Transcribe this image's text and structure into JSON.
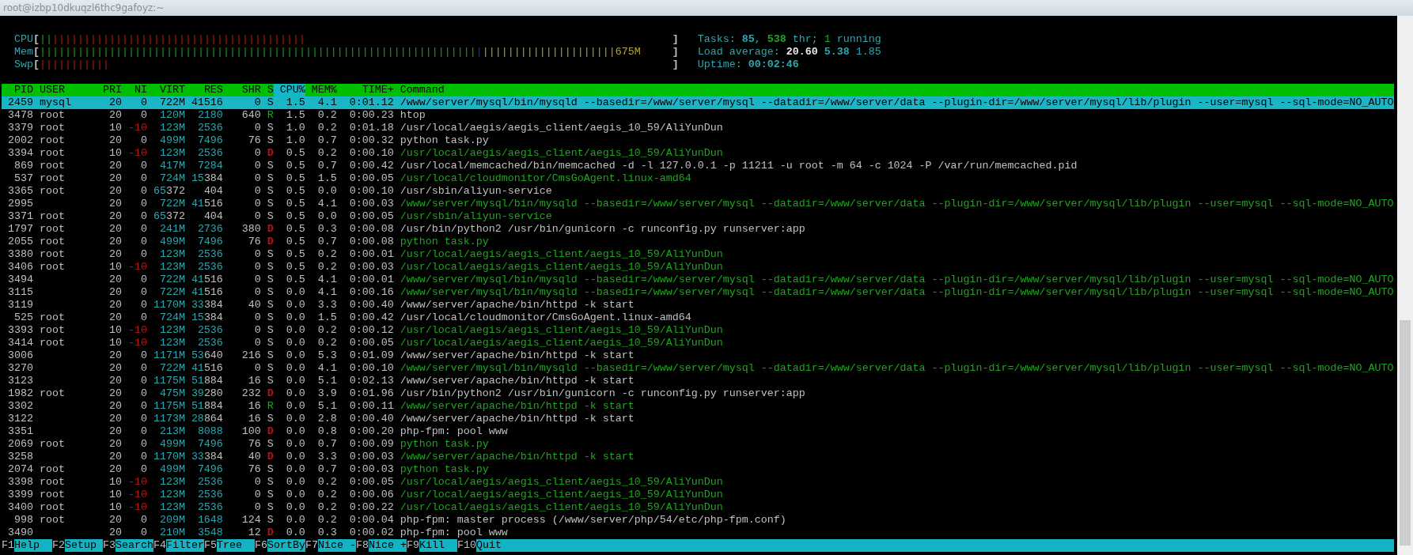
{
  "window": {
    "title": "root@izbp10dkuqzl6thc9gafoyz:~"
  },
  "meters": [
    {
      "label": "CPU",
      "open": "[",
      "close": "]",
      "segments": [
        {
          "text": "||",
          "kind": "user"
        },
        {
          "text": "||||||||||||||||||||||||||||||||||||||||",
          "kind": "kernel"
        }
      ]
    },
    {
      "label": "Mem",
      "open": "[",
      "close": "]",
      "segments": [
        {
          "text": "|||||||||||||||||||||||||||||||||||||||||||||||||||||||||||||||||||||",
          "kind": "used"
        },
        {
          "text": "|",
          "kind": "buffers"
        },
        {
          "text": "|||||||||||||||||||||",
          "kind": "cache"
        }
      ],
      "value": "675M"
    },
    {
      "label": "Swp",
      "open": "[",
      "close": "]",
      "segments": [
        {
          "text": "|||||||||||",
          "kind": "swap"
        }
      ]
    }
  ],
  "summary": [
    [
      {
        "text": "Tasks: ",
        "kind": "label"
      },
      {
        "text": "85",
        "kind": "value"
      },
      {
        "text": ", ",
        "kind": "label"
      },
      {
        "text": "538",
        "kind": "thread"
      },
      {
        "text": " thr; ",
        "kind": "label"
      },
      {
        "text": "1",
        "kind": "running"
      },
      {
        "text": " running",
        "kind": "label"
      }
    ],
    [
      {
        "text": "Load average: ",
        "kind": "label"
      },
      {
        "text": "20.60 ",
        "kind": "bright"
      },
      {
        "text": "5.38",
        "kind": "value"
      },
      {
        "text": " 1.85",
        "kind": "label"
      }
    ],
    [
      {
        "text": "Uptime: ",
        "kind": "label"
      },
      {
        "text": "00:02:46",
        "kind": "value"
      }
    ]
  ],
  "columns": [
    {
      "label": "PID",
      "sorted": false
    },
    {
      "label": "USER",
      "sorted": false
    },
    {
      "label": "PRI",
      "sorted": false
    },
    {
      "label": "NI",
      "sorted": false
    },
    {
      "label": "VIRT",
      "sorted": false
    },
    {
      "label": "RES",
      "sorted": false
    },
    {
      "label": "SHR",
      "sorted": false
    },
    {
      "label": "S",
      "sorted": false
    },
    {
      "label": "CPU%",
      "sorted": true
    },
    {
      "label": "MEM%",
      "sorted": false
    },
    {
      "label": "TIME+",
      "sorted": false
    },
    {
      "label": "Command",
      "sorted": false
    }
  ],
  "rows": [
    {
      "pid": "2459",
      "user": "mysql",
      "pri": "20",
      "ni": "0",
      "virt": "722M",
      "res": "41516",
      "shr": "0",
      "state": "S",
      "cpu": "1.5",
      "mem": "4.1",
      "time": "0:01.12",
      "command": "/www/server/mysql/bin/mysqld --basedir=/www/server/mysql --datadir=/www/server/data --plugin-dir=/www/server/mysql/lib/plugin --user=mysql --sql-mode=NO_AUTO",
      "thread": false,
      "selected": true
    },
    {
      "pid": "3478",
      "user": "root",
      "pri": "20",
      "ni": "0",
      "virt": "120M",
      "res": "2180",
      "shr": "640",
      "state": "R",
      "cpu": "1.5",
      "mem": "0.2",
      "time": "0:00.23",
      "command": "htop",
      "thread": false,
      "selected": false
    },
    {
      "pid": "3379",
      "user": "root",
      "pri": "10",
      "ni": "-10",
      "virt": "123M",
      "res": "2536",
      "shr": "0",
      "state": "S",
      "cpu": "1.0",
      "mem": "0.2",
      "time": "0:01.18",
      "command": "/usr/local/aegis/aegis_client/aegis_10_59/AliYunDun",
      "thread": false,
      "selected": false
    },
    {
      "pid": "2002",
      "user": "root",
      "pri": "20",
      "ni": "0",
      "virt": "499M",
      "res": "7496",
      "shr": "76",
      "state": "S",
      "cpu": "1.0",
      "mem": "0.7",
      "time": "0:00.32",
      "command": "python task.py",
      "thread": false,
      "selected": false
    },
    {
      "pid": "3394",
      "user": "root",
      "pri": "10",
      "ni": "-10",
      "virt": "123M",
      "res": "2536",
      "shr": "0",
      "state": "D",
      "cpu": "0.5",
      "mem": "0.2",
      "time": "0:00.10",
      "command": "/usr/local/aegis/aegis_client/aegis_10_59/AliYunDun",
      "thread": true,
      "selected": false
    },
    {
      "pid": "869",
      "user": "root",
      "pri": "20",
      "ni": "0",
      "virt": "417M",
      "res": "7284",
      "shr": "0",
      "state": "S",
      "cpu": "0.5",
      "mem": "0.7",
      "time": "0:00.42",
      "command": "/usr/local/memcached/bin/memcached -d -l 127.0.0.1 -p 11211 -u root -m 64 -c 1024 -P /var/run/memcached.pid",
      "thread": false,
      "selected": false
    },
    {
      "pid": "537",
      "user": "root",
      "pri": "20",
      "ni": "0",
      "virt": "724M",
      "res": "15384",
      "shr": "0",
      "state": "S",
      "cpu": "0.5",
      "mem": "1.5",
      "time": "0:00.05",
      "command": "/usr/local/cloudmonitor/CmsGoAgent.linux-amd64",
      "thread": true,
      "selected": false
    },
    {
      "pid": "3365",
      "user": "root",
      "pri": "20",
      "ni": "0",
      "virt": "65372",
      "res": "404",
      "shr": "0",
      "state": "S",
      "cpu": "0.5",
      "mem": "0.0",
      "time": "0:00.10",
      "command": "/usr/sbin/aliyun-service",
      "thread": false,
      "selected": false
    },
    {
      "pid": "2995",
      "pri": "20",
      "ni": "0",
      "virt": "722M",
      "res": "41516",
      "shr": "0",
      "state": "S",
      "cpu": "0.5",
      "mem": "4.1",
      "time": "0:00.03",
      "command": "/www/server/mysql/bin/mysqld --basedir=/www/server/mysql --datadir=/www/server/data --plugin-dir=/www/server/mysql/lib/plugin --user=mysql --sql-mode=NO_AUTO",
      "thread": true,
      "selected": false
    },
    {
      "pid": "3371",
      "user": "root",
      "pri": "20",
      "ni": "0",
      "virt": "65372",
      "res": "404",
      "shr": "0",
      "state": "S",
      "cpu": "0.5",
      "mem": "0.0",
      "time": "0:00.05",
      "command": "/usr/sbin/aliyun-service",
      "thread": true,
      "selected": false
    },
    {
      "pid": "1797",
      "user": "root",
      "pri": "20",
      "ni": "0",
      "virt": "241M",
      "res": "2736",
      "shr": "380",
      "state": "D",
      "cpu": "0.5",
      "mem": "0.3",
      "time": "0:00.08",
      "command": "/usr/bin/python2 /usr/bin/gunicorn -c runconfig.py runserver:app",
      "thread": false,
      "selected": false
    },
    {
      "pid": "2055",
      "user": "root",
      "pri": "20",
      "ni": "0",
      "virt": "499M",
      "res": "7496",
      "shr": "76",
      "state": "D",
      "cpu": "0.5",
      "mem": "0.7",
      "time": "0:00.08",
      "command": "python task.py",
      "thread": true,
      "selected": false
    },
    {
      "pid": "3380",
      "user": "root",
      "pri": "20",
      "ni": "0",
      "virt": "123M",
      "res": "2536",
      "shr": "0",
      "state": "S",
      "cpu": "0.5",
      "mem": "0.2",
      "time": "0:00.01",
      "command": "/usr/local/aegis/aegis_client/aegis_10_59/AliYunDun",
      "thread": true,
      "selected": false
    },
    {
      "pid": "3406",
      "user": "root",
      "pri": "10",
      "ni": "-10",
      "virt": "123M",
      "res": "2536",
      "shr": "0",
      "state": "S",
      "cpu": "0.5",
      "mem": "0.2",
      "time": "0:00.03",
      "command": "/usr/local/aegis/aegis_client/aegis_10_59/AliYunDun",
      "thread": true,
      "selected": false
    },
    {
      "pid": "3494",
      "pri": "20",
      "ni": "0",
      "virt": "722M",
      "res": "41516",
      "shr": "0",
      "state": "S",
      "cpu": "0.5",
      "mem": "4.1",
      "time": "0:00.01",
      "command": "/www/server/mysql/bin/mysqld --basedir=/www/server/mysql --datadir=/www/server/data --plugin-dir=/www/server/mysql/lib/plugin --user=mysql --sql-mode=NO_AUTO",
      "thread": true,
      "selected": false
    },
    {
      "pid": "3115",
      "pri": "20",
      "ni": "0",
      "virt": "722M",
      "res": "41516",
      "shr": "0",
      "state": "S",
      "cpu": "0.0",
      "mem": "4.1",
      "time": "0:00.16",
      "command": "/www/server/mysql/bin/mysqld --basedir=/www/server/mysql --datadir=/www/server/data --plugin-dir=/www/server/mysql/lib/plugin --user=mysql --sql-mode=NO_AUTO",
      "thread": true,
      "selected": false
    },
    {
      "pid": "3119",
      "pri": "20",
      "ni": "0",
      "virt": "1170M",
      "res": "33384",
      "shr": "40",
      "state": "S",
      "cpu": "0.0",
      "mem": "3.3",
      "time": "0:00.40",
      "command": "/www/server/apache/bin/httpd -k start",
      "thread": false,
      "selected": false
    },
    {
      "pid": "525",
      "user": "root",
      "pri": "20",
      "ni": "0",
      "virt": "724M",
      "res": "15384",
      "shr": "0",
      "state": "S",
      "cpu": "0.0",
      "mem": "1.5",
      "time": "0:00.42",
      "command": "/usr/local/cloudmonitor/CmsGoAgent.linux-amd64",
      "thread": false,
      "selected": false
    },
    {
      "pid": "3393",
      "user": "root",
      "pri": "10",
      "ni": "-10",
      "virt": "123M",
      "res": "2536",
      "shr": "0",
      "state": "S",
      "cpu": "0.0",
      "mem": "0.2",
      "time": "0:00.12",
      "command": "/usr/local/aegis/aegis_client/aegis_10_59/AliYunDun",
      "thread": true,
      "selected": false
    },
    {
      "pid": "3414",
      "user": "root",
      "pri": "10",
      "ni": "-10",
      "virt": "123M",
      "res": "2536",
      "shr": "0",
      "state": "S",
      "cpu": "0.0",
      "mem": "0.2",
      "time": "0:00.05",
      "command": "/usr/local/aegis/aegis_client/aegis_10_59/AliYunDun",
      "thread": true,
      "selected": false
    },
    {
      "pid": "3006",
      "pri": "20",
      "ni": "0",
      "virt": "1171M",
      "res": "53640",
      "shr": "216",
      "state": "S",
      "cpu": "0.0",
      "mem": "5.3",
      "time": "0:01.09",
      "command": "/www/server/apache/bin/httpd -k start",
      "thread": false,
      "selected": false
    },
    {
      "pid": "3270",
      "pri": "20",
      "ni": "0",
      "virt": "722M",
      "res": "41516",
      "shr": "0",
      "state": "S",
      "cpu": "0.0",
      "mem": "4.1",
      "time": "0:00.10",
      "command": "/www/server/mysql/bin/mysqld --basedir=/www/server/mysql --datadir=/www/server/data --plugin-dir=/www/server/mysql/lib/plugin --user=mysql --sql-mode=NO_AUTO",
      "thread": true,
      "selected": false
    },
    {
      "pid": "3123",
      "pri": "20",
      "ni": "0",
      "virt": "1175M",
      "res": "51884",
      "shr": "16",
      "state": "S",
      "cpu": "0.0",
      "mem": "5.1",
      "time": "0:02.13",
      "command": "/www/server/apache/bin/httpd -k start",
      "thread": false,
      "selected": false
    },
    {
      "pid": "1982",
      "user": "root",
      "pri": "20",
      "ni": "0",
      "virt": "475M",
      "res": "39280",
      "shr": "232",
      "state": "D",
      "cpu": "0.0",
      "mem": "3.9",
      "time": "0:01.96",
      "command": "/usr/bin/python2 /usr/bin/gunicorn -c runconfig.py runserver:app",
      "thread": false,
      "selected": false
    },
    {
      "pid": "3302",
      "pri": "20",
      "ni": "0",
      "virt": "1175M",
      "res": "51884",
      "shr": "16",
      "state": "R",
      "cpu": "0.0",
      "mem": "5.1",
      "time": "0:00.11",
      "command": "/www/server/apache/bin/httpd -k start",
      "thread": true,
      "selected": false
    },
    {
      "pid": "3122",
      "pri": "20",
      "ni": "0",
      "virt": "1173M",
      "res": "28864",
      "shr": "16",
      "state": "S",
      "cpu": "0.0",
      "mem": "2.8",
      "time": "0:00.40",
      "command": "/www/server/apache/bin/httpd -k start",
      "thread": false,
      "selected": false
    },
    {
      "pid": "3351",
      "pri": "20",
      "ni": "0",
      "virt": "213M",
      "res": "8088",
      "shr": "100",
      "state": "D",
      "cpu": "0.0",
      "mem": "0.8",
      "time": "0:00.20",
      "command": "php-fpm: pool www",
      "thread": false,
      "selected": false
    },
    {
      "pid": "2069",
      "user": "root",
      "pri": "20",
      "ni": "0",
      "virt": "499M",
      "res": "7496",
      "shr": "76",
      "state": "S",
      "cpu": "0.0",
      "mem": "0.7",
      "time": "0:00.09",
      "command": "python task.py",
      "thread": true,
      "selected": false
    },
    {
      "pid": "3258",
      "pri": "20",
      "ni": "0",
      "virt": "1170M",
      "res": "33384",
      "shr": "40",
      "state": "D",
      "cpu": "0.0",
      "mem": "3.3",
      "time": "0:00.03",
      "command": "/www/server/apache/bin/httpd -k start",
      "thread": true,
      "selected": false
    },
    {
      "pid": "2074",
      "user": "root",
      "pri": "20",
      "ni": "0",
      "virt": "499M",
      "res": "7496",
      "shr": "76",
      "state": "S",
      "cpu": "0.0",
      "mem": "0.7",
      "time": "0:00.03",
      "command": "python task.py",
      "thread": true,
      "selected": false
    },
    {
      "pid": "3398",
      "user": "root",
      "pri": "10",
      "ni": "-10",
      "virt": "123M",
      "res": "2536",
      "shr": "0",
      "state": "S",
      "cpu": "0.0",
      "mem": "0.2",
      "time": "0:00.05",
      "command": "/usr/local/aegis/aegis_client/aegis_10_59/AliYunDun",
      "thread": true,
      "selected": false
    },
    {
      "pid": "3399",
      "user": "root",
      "pri": "10",
      "ni": "-10",
      "virt": "123M",
      "res": "2536",
      "shr": "0",
      "state": "S",
      "cpu": "0.0",
      "mem": "0.2",
      "time": "0:00.06",
      "command": "/usr/local/aegis/aegis_client/aegis_10_59/AliYunDun",
      "thread": true,
      "selected": false
    },
    {
      "pid": "3400",
      "user": "root",
      "pri": "10",
      "ni": "-10",
      "virt": "123M",
      "res": "2536",
      "shr": "0",
      "state": "S",
      "cpu": "0.0",
      "mem": "0.2",
      "time": "0:00.22",
      "command": "/usr/local/aegis/aegis_client/aegis_10_59/AliYunDun",
      "thread": true,
      "selected": false
    },
    {
      "pid": "998",
      "user": "root",
      "pri": "20",
      "ni": "0",
      "virt": "209M",
      "res": "1648",
      "shr": "124",
      "state": "S",
      "cpu": "0.0",
      "mem": "0.2",
      "time": "0:00.04",
      "command": "php-fpm: master process (/www/server/php/54/etc/php-fpm.conf)",
      "thread": false,
      "selected": false
    },
    {
      "pid": "3490",
      "pri": "20",
      "ni": "0",
      "virt": "210M",
      "res": "3548",
      "shr": "12",
      "state": "D",
      "cpu": "0.0",
      "mem": "0.3",
      "time": "0:00.02",
      "command": "php-fpm: pool www",
      "thread": false,
      "selected": false
    }
  ],
  "function_keys": [
    {
      "key": "F1",
      "label": "Help"
    },
    {
      "key": "F2",
      "label": "Setup"
    },
    {
      "key": "F3",
      "label": "Search"
    },
    {
      "key": "F4",
      "label": "Filter"
    },
    {
      "key": "F5",
      "label": "Tree"
    },
    {
      "key": "F6",
      "label": "SortBy"
    },
    {
      "key": "F7",
      "label": "Nice -"
    },
    {
      "key": "F8",
      "label": "Nice +"
    },
    {
      "key": "F9",
      "label": "Kill"
    },
    {
      "key": "F10",
      "label": "Quit"
    }
  ]
}
